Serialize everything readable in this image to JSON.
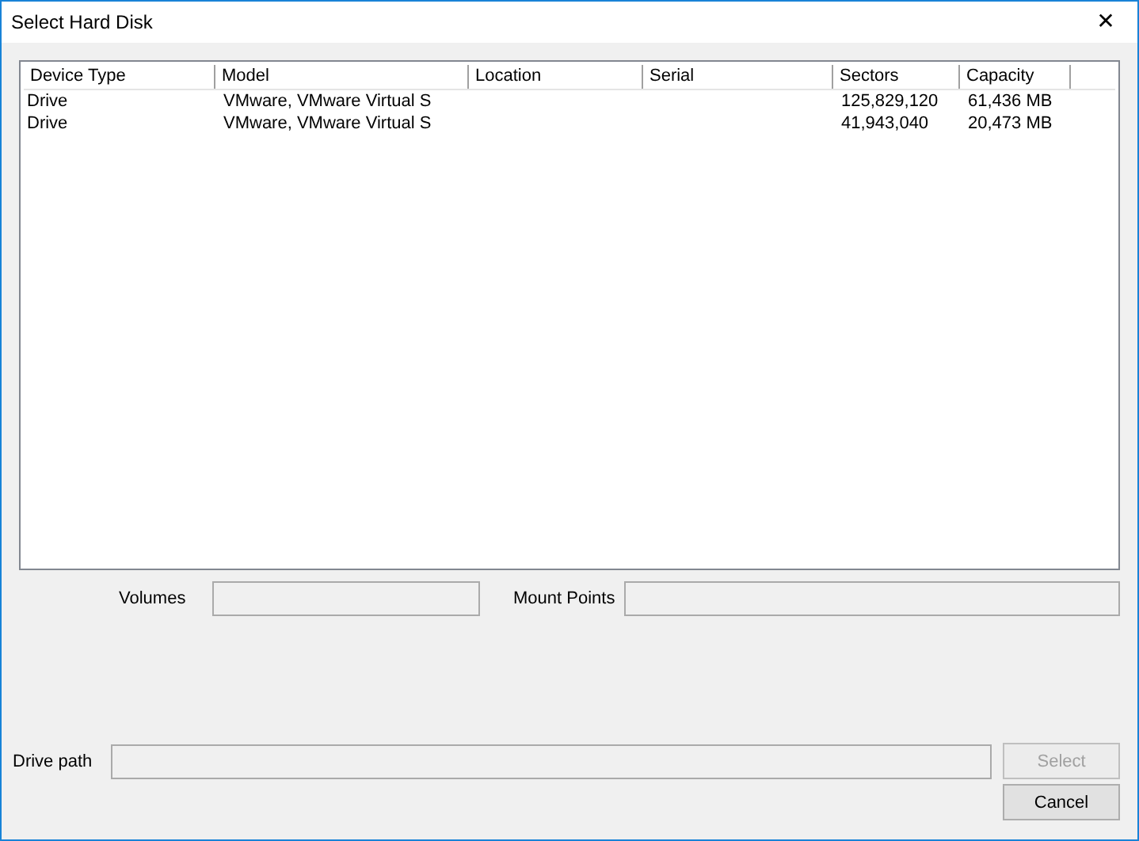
{
  "window": {
    "title": "Select Hard Disk",
    "close": "✕"
  },
  "table": {
    "columns": [
      "Device Type",
      "Model",
      "Location",
      "Serial",
      "Sectors",
      "Capacity"
    ],
    "rows": [
      [
        "Drive",
        "VMware, VMware Virtual S",
        "",
        "",
        "125,829,120",
        "61,436 MB"
      ],
      [
        "Drive",
        "VMware, VMware Virtual S",
        "",
        "",
        "41,943,040",
        "20,473 MB"
      ]
    ]
  },
  "volumes": {
    "label": "Volumes"
  },
  "mount_points": {
    "label": "Mount Points"
  },
  "drive_path": {
    "label": "Drive path"
  },
  "buttons": [
    {
      "label": "Select",
      "disabled": true
    },
    {
      "label": "Cancel",
      "disabled": false
    }
  ]
}
